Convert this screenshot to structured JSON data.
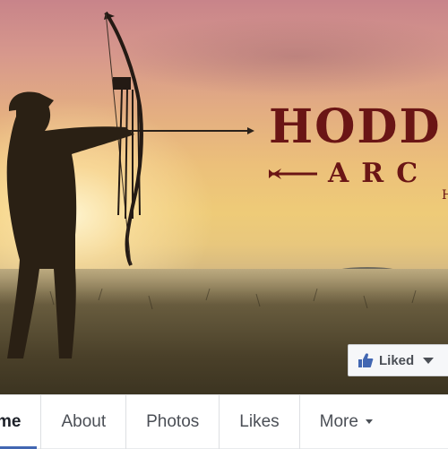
{
  "cover": {
    "brand_line1": "HODD",
    "brand_line2": "ARC",
    "brand_small": "H"
  },
  "like_button": {
    "label": "Liked",
    "icon": "thumbs-up-icon"
  },
  "tabs": [
    {
      "label": "me",
      "active": true
    },
    {
      "label": "About"
    },
    {
      "label": "Photos"
    },
    {
      "label": "Likes"
    },
    {
      "label": "More",
      "icon": "caret-down-icon"
    }
  ],
  "colors": {
    "brand_red": "#6a1515",
    "facebook_blue": "#4267b2",
    "tab_text": "#4b4f56"
  }
}
